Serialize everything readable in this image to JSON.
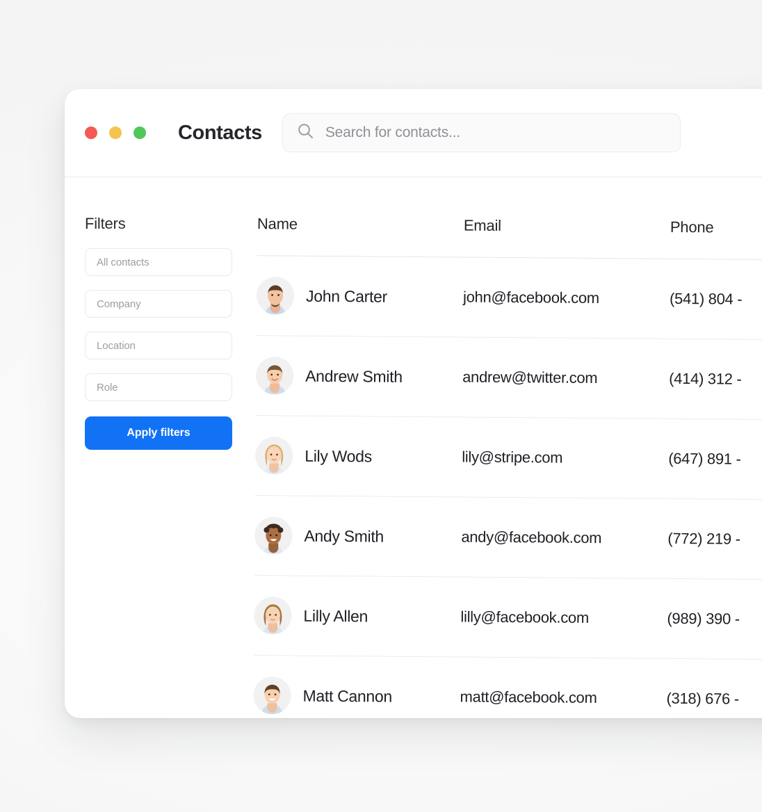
{
  "window": {
    "title": "Contacts",
    "traffic_lights": [
      {
        "name": "close",
        "color": "#f45953"
      },
      {
        "name": "minimize",
        "color": "#f5c34f"
      },
      {
        "name": "maximize",
        "color": "#4fc859"
      }
    ]
  },
  "search": {
    "placeholder": "Search for contacts...",
    "value": "",
    "icon": "search-icon"
  },
  "filters": {
    "title": "Filters",
    "fields": [
      {
        "name": "all-contacts",
        "placeholder": "All contacts",
        "value": ""
      },
      {
        "name": "company",
        "placeholder": "Company",
        "value": ""
      },
      {
        "name": "location",
        "placeholder": "Location",
        "value": ""
      },
      {
        "name": "role",
        "placeholder": "Role",
        "value": ""
      }
    ],
    "apply_label": "Apply filters",
    "apply_color": "#1172f6"
  },
  "table": {
    "columns": [
      "Name",
      "Email",
      "Phone"
    ],
    "rows": [
      {
        "name": "John Carter",
        "email": "john@facebook.com",
        "phone": "(541) 804 -",
        "avatar": "avatar-man-beard"
      },
      {
        "name": "Andrew Smith",
        "email": "andrew@twitter.com",
        "phone": "(414) 312 -",
        "avatar": "avatar-man-short-hair"
      },
      {
        "name": "Lily Wods",
        "email": "lily@stripe.com",
        "phone": "(647) 891 -",
        "avatar": "avatar-woman-blonde"
      },
      {
        "name": "Andy Smith",
        "email": "andy@facebook.com",
        "phone": "(772) 219 -",
        "avatar": "avatar-man-curly"
      },
      {
        "name": "Lilly Allen",
        "email": "lilly@facebook.com",
        "phone": "(989) 390 -",
        "avatar": "avatar-woman-brunette"
      },
      {
        "name": "Matt Cannon",
        "email": "matt@facebook.com",
        "phone": "(318) 676 -",
        "avatar": "avatar-man-smiling"
      }
    ]
  }
}
